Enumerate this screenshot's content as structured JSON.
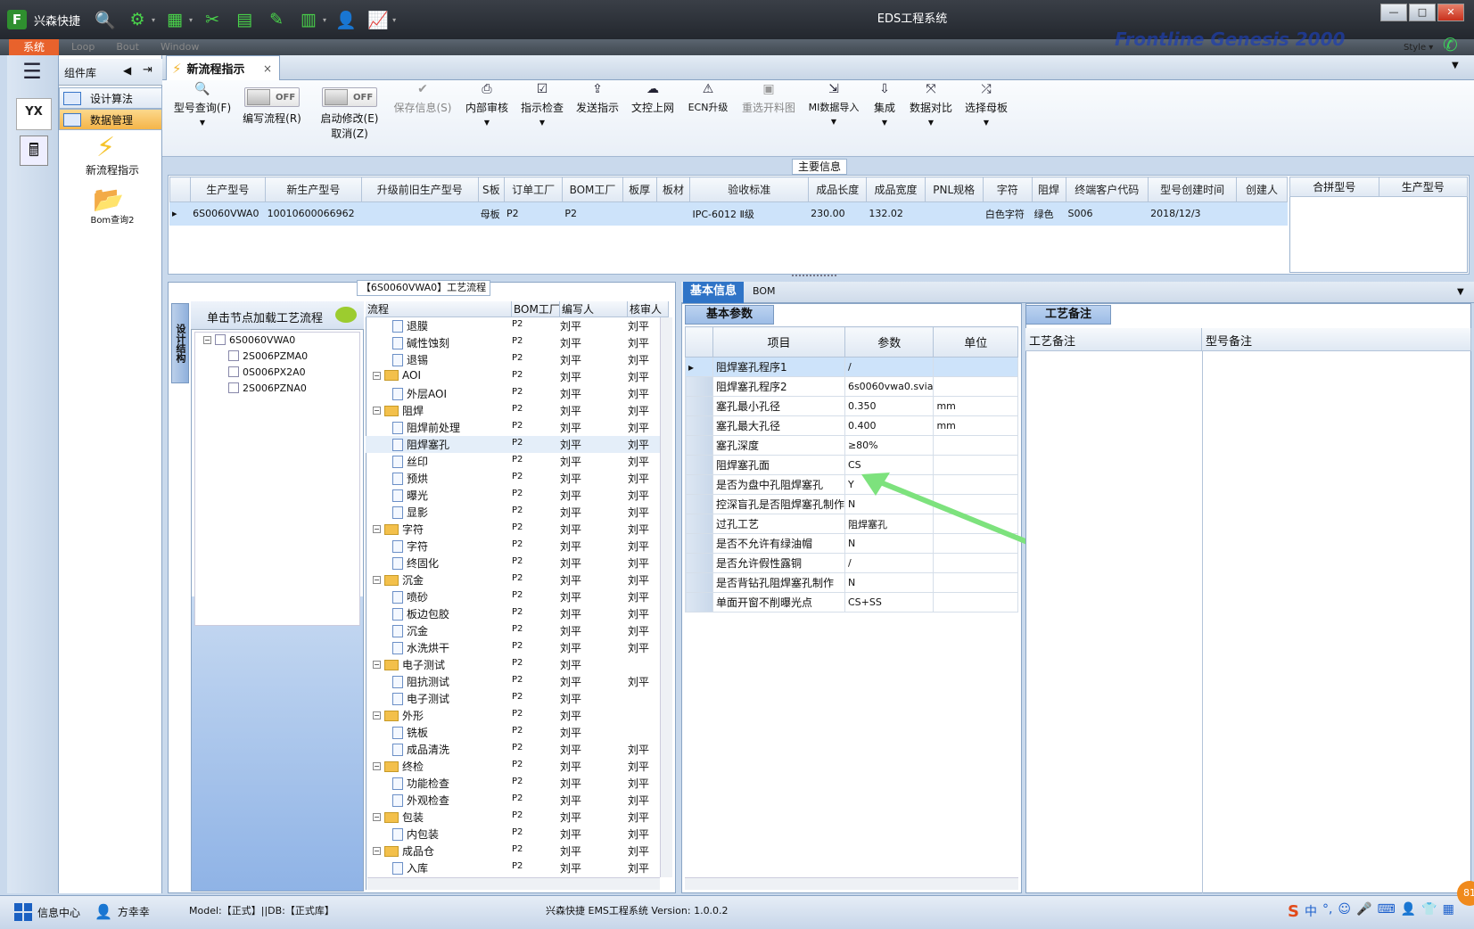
{
  "app": {
    "quick_title": "兴森快捷",
    "window_title": "EDS工程系统",
    "menu": {
      "system": "系统",
      "items": [
        "Loop",
        "Bout",
        "Window"
      ]
    },
    "brand": "Frontline Genesis 2000",
    "style_label": "Style",
    "window_buttons": [
      "—",
      "□",
      "✕"
    ]
  },
  "sidebar": {
    "panel_title": "组件库",
    "items": [
      {
        "label": "设计算法"
      },
      {
        "label": "数据管理",
        "selected": true
      }
    ],
    "launchers": [
      {
        "label": "新流程指示",
        "icon": "lightning-icon"
      },
      {
        "label": "Bom查询2",
        "icon": "folder-icon"
      }
    ],
    "strip_logo": "YX"
  },
  "tabs": [
    {
      "label": "新流程指示",
      "close": "×"
    }
  ],
  "toolbar": {
    "buttons": [
      {
        "label": "型号查询(F)",
        "icon": "search-icon",
        "dropdown": true,
        "enabled": true
      },
      {
        "label": "编写流程(R)",
        "toggle": "OFF",
        "enabled": true
      },
      {
        "label": "启动修改(E)",
        "sublabel": "取消(Z)",
        "toggle": "OFF",
        "enabled": true
      },
      {
        "label": "保存信息(S)",
        "icon": "check-icon",
        "enabled": false
      },
      {
        "label": "内部审核",
        "icon": "print-icon",
        "dropdown": true,
        "enabled": true
      },
      {
        "label": "指示检查",
        "icon": "checkbox-icon",
        "dropdown": true,
        "enabled": true
      },
      {
        "label": "发送指示",
        "icon": "upload-icon",
        "enabled": true
      },
      {
        "label": "文控上网",
        "icon": "cloud-icon",
        "enabled": true
      },
      {
        "label": "ECN升级",
        "icon": "ecn-icon",
        "enabled": true
      },
      {
        "label": "重选开料图",
        "icon": "image-icon",
        "enabled": false
      },
      {
        "label": "MI数据导入",
        "icon": "import-icon",
        "dropdown": true,
        "enabled": true
      },
      {
        "label": "集成",
        "icon": "download-icon",
        "dropdown": true,
        "enabled": true
      },
      {
        "label": "数据对比",
        "icon": "compare-icon",
        "dropdown": true,
        "enabled": true
      },
      {
        "label": "选择母板",
        "icon": "shuffle-icon",
        "dropdown": true,
        "enabled": true
      }
    ]
  },
  "main_info": {
    "label": "主要信息",
    "columns": [
      "生产型号",
      "新生产型号",
      "升级前旧生产型号",
      "S板",
      "订单工厂",
      "BOM工厂",
      "板厚",
      "板材",
      "验收标准",
      "成品长度",
      "成品宽度",
      "PNL规格",
      "字符",
      "阻焊",
      "终端客户代码",
      "型号创建时间",
      "创建人"
    ],
    "rows": [
      [
        "6S0060VWA0",
        "10010600066962",
        "",
        "母板",
        "P2",
        "P2",
        "",
        "",
        "IPC-6012 Ⅱ级",
        "230.00",
        "132.02",
        "",
        "白色字符",
        "绿色",
        "S006",
        "2018/12/3",
        ""
      ]
    ],
    "side_columns": [
      "合拼型号",
      "生产型号"
    ]
  },
  "process": {
    "label": "【6S0060VWA0】工艺流程",
    "vertical_tab": "设计结构",
    "tree_header": "单击节点加载工艺流程",
    "tree": [
      {
        "label": "6S0060VWA0",
        "root": true
      },
      {
        "label": "2S006PZMA0"
      },
      {
        "label": "0S006PX2A0"
      },
      {
        "label": "2S006PZNA0"
      }
    ],
    "columns": [
      "流程",
      "BOM工厂",
      "编写人",
      "核审人"
    ],
    "rows": [
      {
        "name": "退膜",
        "type": "leaf",
        "factory": "P2",
        "writer": "刘平",
        "reviewer": "刘平"
      },
      {
        "name": "碱性蚀刻",
        "type": "leaf",
        "factory": "P2",
        "writer": "刘平",
        "reviewer": "刘平"
      },
      {
        "name": "退锡",
        "type": "leaf",
        "factory": "P2",
        "writer": "刘平",
        "reviewer": "刘平"
      },
      {
        "name": "AOI",
        "type": "group",
        "factory": "P2",
        "writer": "刘平",
        "reviewer": "刘平"
      },
      {
        "name": "外层AOI",
        "type": "leaf",
        "factory": "P2",
        "writer": "刘平",
        "reviewer": "刘平"
      },
      {
        "name": "阻焊",
        "type": "group",
        "factory": "P2",
        "writer": "刘平",
        "reviewer": "刘平"
      },
      {
        "name": "阻焊前处理",
        "type": "leaf",
        "factory": "P2",
        "writer": "刘平",
        "reviewer": "刘平"
      },
      {
        "name": "阻焊塞孔",
        "type": "leaf",
        "factory": "P2",
        "writer": "刘平",
        "reviewer": "刘平"
      },
      {
        "name": "丝印",
        "type": "leaf",
        "factory": "P2",
        "writer": "刘平",
        "reviewer": "刘平"
      },
      {
        "name": "预烘",
        "type": "leaf",
        "factory": "P2",
        "writer": "刘平",
        "reviewer": "刘平"
      },
      {
        "name": "曝光",
        "type": "leaf",
        "factory": "P2",
        "writer": "刘平",
        "reviewer": "刘平"
      },
      {
        "name": "显影",
        "type": "leaf",
        "factory": "P2",
        "writer": "刘平",
        "reviewer": "刘平"
      },
      {
        "name": "字符",
        "type": "group",
        "factory": "P2",
        "writer": "刘平",
        "reviewer": "刘平"
      },
      {
        "name": "字符",
        "type": "leaf",
        "factory": "P2",
        "writer": "刘平",
        "reviewer": "刘平"
      },
      {
        "name": "终固化",
        "type": "leaf",
        "factory": "P2",
        "writer": "刘平",
        "reviewer": "刘平"
      },
      {
        "name": "沉金",
        "type": "group",
        "factory": "P2",
        "writer": "刘平",
        "reviewer": "刘平"
      },
      {
        "name": "喷砂",
        "type": "leaf",
        "factory": "P2",
        "writer": "刘平",
        "reviewer": "刘平"
      },
      {
        "name": "板边包胶",
        "type": "leaf",
        "factory": "P2",
        "writer": "刘平",
        "reviewer": "刘平"
      },
      {
        "name": "沉金",
        "type": "leaf",
        "factory": "P2",
        "writer": "刘平",
        "reviewer": "刘平"
      },
      {
        "name": "水洗烘干",
        "type": "leaf",
        "factory": "P2",
        "writer": "刘平",
        "reviewer": "刘平"
      },
      {
        "name": "电子测试",
        "type": "group",
        "factory": "P2",
        "writer": "刘平",
        "reviewer": ""
      },
      {
        "name": "阻抗测试",
        "type": "leaf",
        "factory": "P2",
        "writer": "刘平",
        "reviewer": "刘平"
      },
      {
        "name": "电子测试",
        "type": "leaf",
        "factory": "P2",
        "writer": "刘平",
        "reviewer": ""
      },
      {
        "name": "外形",
        "type": "group",
        "factory": "P2",
        "writer": "刘平",
        "reviewer": ""
      },
      {
        "name": "铣板",
        "type": "leaf",
        "factory": "P2",
        "writer": "刘平",
        "reviewer": ""
      },
      {
        "name": "成品清洗",
        "type": "leaf",
        "factory": "P2",
        "writer": "刘平",
        "reviewer": "刘平"
      },
      {
        "name": "终检",
        "type": "group",
        "factory": "P2",
        "writer": "刘平",
        "reviewer": "刘平"
      },
      {
        "name": "功能检查",
        "type": "leaf",
        "factory": "P2",
        "writer": "刘平",
        "reviewer": "刘平"
      },
      {
        "name": "外观检查",
        "type": "leaf",
        "factory": "P2",
        "writer": "刘平",
        "reviewer": "刘平"
      },
      {
        "name": "包装",
        "type": "group",
        "factory": "P2",
        "writer": "刘平",
        "reviewer": "刘平"
      },
      {
        "name": "内包装",
        "type": "leaf",
        "factory": "P2",
        "writer": "刘平",
        "reviewer": "刘平"
      },
      {
        "name": "成品仓",
        "type": "group",
        "factory": "P2",
        "writer": "刘平",
        "reviewer": "刘平"
      },
      {
        "name": "入库",
        "type": "leaf",
        "factory": "P2",
        "writer": "刘平",
        "reviewer": "刘平"
      }
    ]
  },
  "basic_info": {
    "tabs": [
      "基本信息",
      "BOM"
    ],
    "section": "基本参数",
    "columns": [
      "项目",
      "参数",
      "单位"
    ],
    "rows": [
      [
        "阻焊塞孔程序1",
        "/",
        ""
      ],
      [
        "阻焊塞孔程序2",
        "6s0060vwa0.svia",
        ""
      ],
      [
        "塞孔最小孔径",
        "0.350",
        "mm"
      ],
      [
        "塞孔最大孔径",
        "0.400",
        "mm"
      ],
      [
        "塞孔深度",
        "≥80%",
        ""
      ],
      [
        "阻焊塞孔面",
        "CS",
        ""
      ],
      [
        "是否为盘中孔阻焊塞孔",
        "Y",
        ""
      ],
      [
        "控深盲孔是否阻焊塞孔制作",
        "N",
        ""
      ],
      [
        "过孔工艺",
        "阻焊塞孔",
        ""
      ],
      [
        "是否不允许有绿油帽",
        "N",
        ""
      ],
      [
        "是否允许假性露铜",
        "/",
        ""
      ],
      [
        "是否背钻孔阻焊塞孔制作",
        "N",
        ""
      ],
      [
        "单面开窗不削曝光点",
        "CS+SS",
        ""
      ]
    ],
    "arrow_color": "#7de27d"
  },
  "remarks": {
    "section": "工艺备注",
    "columns": [
      "工艺备注",
      "型号备注"
    ]
  },
  "status": {
    "info_center": "信息中心",
    "user": "方幸幸",
    "db": "Model:【正式】||DB:【正式库】",
    "version": "兴森快捷 EMS工程系统 Version: 1.0.0.2",
    "tray_badge": "81",
    "ime": [
      "S",
      "中",
      "°,",
      "☺",
      "🎤",
      "⌨",
      "👤",
      "👕",
      "▦"
    ]
  }
}
